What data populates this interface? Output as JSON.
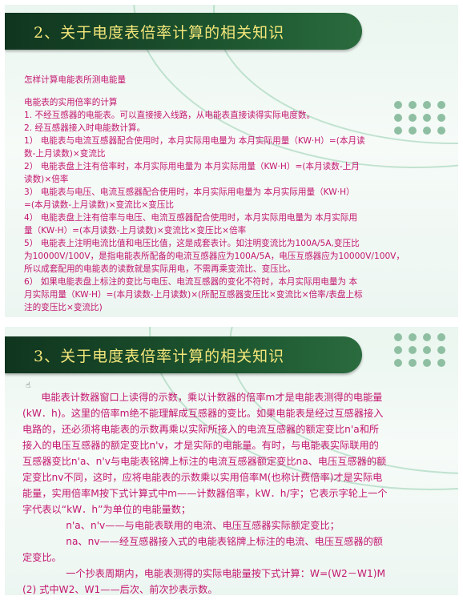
{
  "slide1": {
    "title": "2、关于电度表倍率计算的相关知识",
    "heading": "怎样计算电能表所测电能量",
    "lines": [
      "电能表的实用倍率的计算",
      "1. 不经互感器的电能表。可以直接接入线路，从电能表直接读得实际电度数。",
      " 2. 经互感器接入时电能数计算。",
      "1）  电能表与电流互感器配合使用时，本月实际用电量为 本月实际用量（KW·H）=(本月读",
      "数-上月读数)×变流比",
      "2）  电能表盘上注有倍率时，本月实际用电量为 本月实际用量（KW·H）=(本月读数-上月",
      "读数)×倍率",
      "3）  电能表与电压、电流互感器配合使用时，本月实际用电量为    本月实际用量（KW·H）",
      "=(本月读数-上月读数)×变流比×变压比",
      "4）  电能表盘上注有倍率与电压、电流互感器配合使用时，本月实际用电量为 本月实际用",
      "量（KW·H）=(本月读数-上月读数)×变流比×变压比×倍率",
      "5）  电能表上注明电流比值和电压比值，这是成套表计。如注明变流比为100A/5A,变压比",
      "为10000V/100V，是指电能表所配备的电流互感器应为100A/5A，电压互感器应为10000V/100V，",
      "所以成套配用的电能表的读数就是实际用电，不需再乘变流比、变压比。",
      "6）  如果电能表盘上标注的变比与电压、电流互感器的变化不符时，本月实际用电量为 本",
      "月实际用量（KW·H）=(本月读数-上月读数)×(所配互感器变压比×变流比×倍率/表盘上标",
      "注的变压比×变流比)"
    ]
  },
  "slide2": {
    "title": "3、关于电度表倍率计算的相关知识",
    "lines": [
      "      电能表计数器窗口上读得的示数，乘以计数器的倍率m才是电能表测得的电能量",
      "(kW．h)。这里的倍率m绝不能理解成互感器的变比。如果电能表是经过互感器接入",
      "电路的，还必须将电能表的示数再乘以实际所接入的电流互感器的额定变比n'a和所",
      "接入的电压互感器的额定变比n'v，才是实际的电能量。有时，与电能表实际联用的",
      "互感器变比n'a、n'v与电能表铭牌上标注的电流互感器额定变比na、电压互感器的额",
      "定变比nv不同，这时，应将电能表的示数乘以实用倍率M(也称计费倍率)才是实际电",
      "能量，实用倍率M按下式计算式中m——计数器倍率，kW．h/字；它表示字轮上一个",
      "字代表以“kW．h”为单位的电能量数；",
      "              n'a、n'v——与电能表联用的电流、电压互感器实际额定变比；",
      "              na、nv——经互感器接入式的电能表铭牌上标注的电流、电压互感器的额",
      "定变比。",
      "              一个抄表周期内，电能表测得的实际电能量按下式计算：W=(W2－W1)M",
      "(2) 式中W2、W1——后次、前次抄表示数。"
    ]
  },
  "colors": {
    "text": "#c4166f",
    "title": "#f4e77a",
    "banner": "#1f5a32"
  }
}
